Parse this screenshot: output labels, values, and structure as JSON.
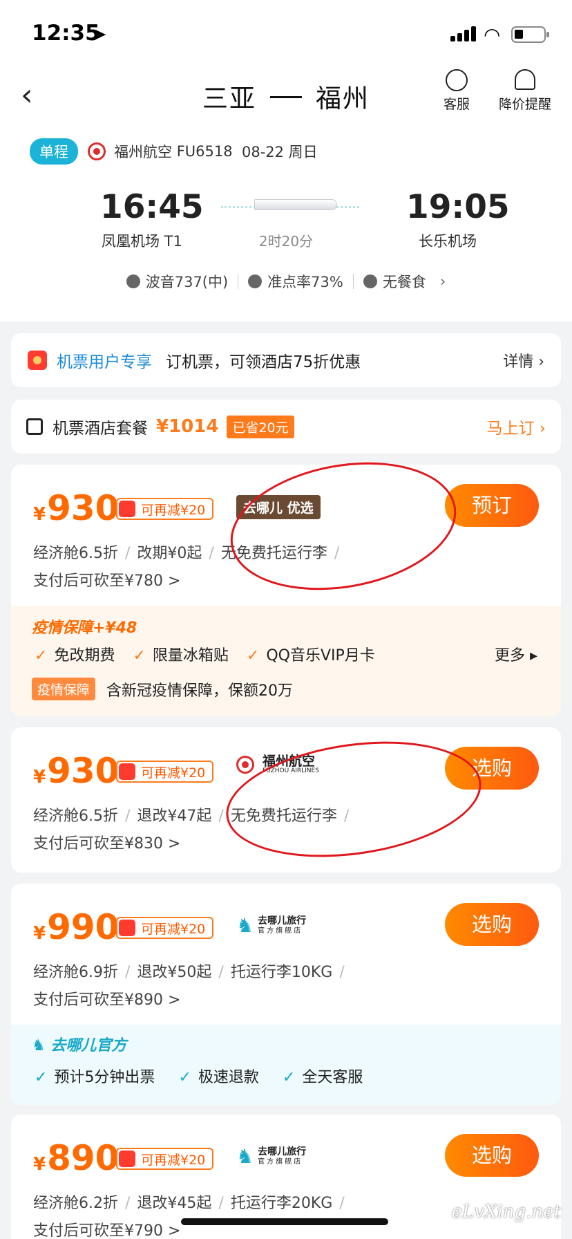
{
  "status": {
    "time": "12:35",
    "loc_icon": "location-arrow-icon"
  },
  "header": {
    "from": "三亚",
    "to": "福州",
    "service": "客服",
    "alert": "降价提醒"
  },
  "trip": {
    "type": "单程",
    "airline": "福州航空",
    "flight": "FU6518",
    "date": "08-22 周日",
    "dep_time": "16:45",
    "dep_airport": "凤凰机场 T1",
    "arr_time": "19:05",
    "arr_airport": "长乐机场",
    "duration": "2时20分",
    "aircraft": "波音737(中)",
    "ontime": "准点率73%",
    "meal": "无餐食"
  },
  "promo": {
    "label": "机票用户专享",
    "text": "订机票，可领酒店75折优惠",
    "more": "详情 ›"
  },
  "package": {
    "label": "机票酒店套餐",
    "price": "¥1014",
    "saved": "已省20元",
    "cta": "马上订 ›"
  },
  "offers": [
    {
      "price": "930",
      "coupon": "可再减¥20",
      "brand": "去哪儿 优选",
      "btn": "预订",
      "fare": [
        "经济舱6.5折",
        "改期¥0起",
        "无免费托运行李"
      ],
      "sub": "支付后可砍至¥780 >"
    },
    {
      "price": "930",
      "coupon": "可再减¥20",
      "brand": "福州航空",
      "brand_en": "FUZHOU AIRLINES",
      "btn": "选购",
      "fare": [
        "经济舱6.5折",
        "退改¥47起",
        "无免费托运行李"
      ],
      "sub": "支付后可砍至¥830 >"
    },
    {
      "price": "990",
      "coupon": "可再减¥20",
      "brand": "去哪儿旅行",
      "brand_sub": "官方旗舰店",
      "btn": "选购",
      "fare": [
        "经济舱6.9折",
        "退改¥50起",
        "托运行李10KG"
      ],
      "sub": "支付后可砍至¥890 >"
    },
    {
      "price": "890",
      "coupon": "可再减¥20",
      "brand": "去哪儿旅行",
      "brand_sub": "官方旗舰店",
      "btn": "选购",
      "fare": [
        "经济舱6.2折",
        "退改¥45起",
        "托运行李20KG"
      ],
      "sub": "支付后可砍至¥790 >"
    }
  ],
  "insurance": {
    "title": "疫情保障+¥48",
    "perks": [
      "免改期费",
      "限量冰箱贴",
      "QQ音乐VIP月卡"
    ],
    "more": "更多",
    "tag": "疫情保障",
    "desc": "含新冠疫情保障，保额20万"
  },
  "official": {
    "title": "去哪儿官方",
    "perks": [
      "预计5分钟出票",
      "极速退款",
      "全天客服"
    ]
  },
  "watermark": "eLvXing.net"
}
